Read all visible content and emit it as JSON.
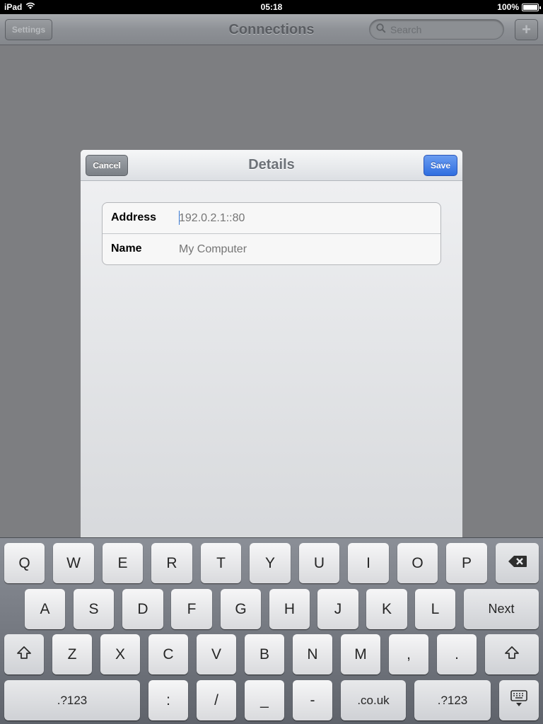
{
  "status_bar": {
    "device": "iPad",
    "time": "05:18",
    "battery": "100%",
    "battery_level": 1.0
  },
  "navbar": {
    "title": "Connections",
    "settings_label": "Settings",
    "search_placeholder": "Search",
    "add_label": "+"
  },
  "modal": {
    "title": "Details",
    "cancel_label": "Cancel",
    "save_label": "Save",
    "fields": [
      {
        "label": "Address",
        "placeholder": "192.0.2.1::80",
        "value": ""
      },
      {
        "label": "Name",
        "placeholder": "My Computer",
        "value": ""
      }
    ]
  },
  "keyboard": {
    "row1": [
      "Q",
      "W",
      "E",
      "R",
      "T",
      "Y",
      "U",
      "I",
      "O",
      "P"
    ],
    "row2": [
      "A",
      "S",
      "D",
      "F",
      "G",
      "H",
      "J",
      "K",
      "L"
    ],
    "next_label": "Next",
    "row3": [
      "Z",
      "X",
      "C",
      "V",
      "B",
      "N",
      "M",
      ",",
      "."
    ],
    "row4": [
      ".?123",
      ":",
      "/",
      "_",
      "-",
      ".co.uk",
      ".?123"
    ]
  },
  "colors": {
    "save_blue": "#2f6ee0",
    "background_dim": "#7d7e81",
    "keyboard": "#6f737b"
  }
}
